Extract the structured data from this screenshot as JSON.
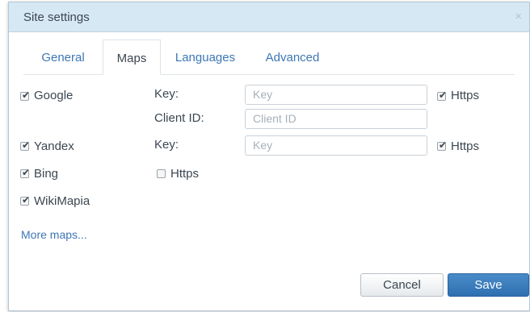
{
  "dialog": {
    "title": "Site settings",
    "close_symbol": "×"
  },
  "tabs": [
    {
      "label": "General",
      "active": false
    },
    {
      "label": "Maps",
      "active": true
    },
    {
      "label": "Languages",
      "active": false
    },
    {
      "label": "Advanced",
      "active": false
    }
  ],
  "maps": {
    "google": {
      "label": "Google",
      "checked": true,
      "key_label": "Key:",
      "key_placeholder": "Key",
      "client_id_label": "Client ID:",
      "client_id_placeholder": "Client ID",
      "https_label": "Https",
      "https_checked": true
    },
    "yandex": {
      "label": "Yandex",
      "checked": true,
      "key_label": "Key:",
      "key_placeholder": "Key",
      "https_label": "Https",
      "https_checked": true
    },
    "bing": {
      "label": "Bing",
      "checked": true,
      "https_label": "Https",
      "https_checked": false
    },
    "wikimapia": {
      "label": "WikiMapia",
      "checked": true
    }
  },
  "more_maps_link": "More maps...",
  "footer": {
    "cancel_label": "Cancel",
    "save_label": "Save"
  },
  "colors": {
    "link": "#3d77b5",
    "titlebar": "#d7e8f5",
    "save": "#3576b8"
  },
  "check_symbol": "✔"
}
